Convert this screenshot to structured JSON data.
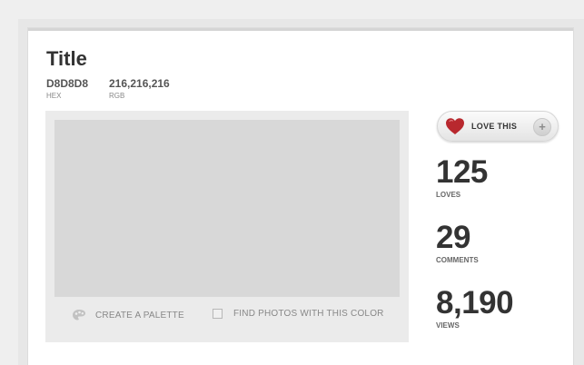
{
  "color": {
    "title": "Title",
    "hex_value": "D8D8D8",
    "hex_label": "HEX",
    "rgb_value": "216,216,216",
    "rgb_label": "RGB",
    "swatch_color": "#d8d8d8"
  },
  "actions": {
    "create_palette": "CREATE A PALETTE",
    "find_photos": "FIND PHOTOS WITH THIS COLOR"
  },
  "love_button": {
    "label": "LOVE THIS",
    "plus": "+",
    "heart_color": "#b8282e"
  },
  "stats": {
    "loves": {
      "value": "125",
      "label": "LOVES"
    },
    "comments": {
      "value": "29",
      "label": "COMMENTS"
    },
    "views": {
      "value": "8,190",
      "label": "VIEWS"
    }
  }
}
